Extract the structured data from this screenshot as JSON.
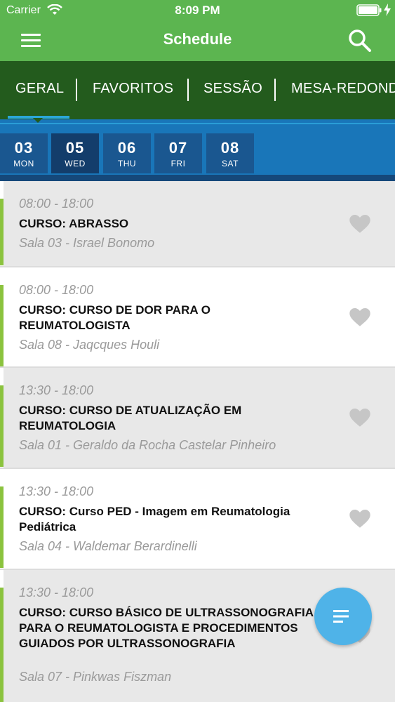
{
  "status_bar": {
    "carrier": "Carrier",
    "time": "8:09 PM"
  },
  "nav": {
    "title": "Schedule",
    "menu_icon": "hamburger-icon",
    "search_icon": "search-icon"
  },
  "tabs": [
    {
      "label": "GERAL",
      "selected": true
    },
    {
      "label": "FAVORITOS",
      "selected": false
    },
    {
      "label": "SESSÃO",
      "selected": false
    },
    {
      "label": "MESA-REDONDA",
      "selected": false
    }
  ],
  "dates": [
    {
      "num": "03",
      "day": "MON",
      "selected": false
    },
    {
      "num": "05",
      "day": "WED",
      "selected": true
    },
    {
      "num": "06",
      "day": "THU",
      "selected": false
    },
    {
      "num": "07",
      "day": "FRI",
      "selected": false
    },
    {
      "num": "08",
      "day": "SAT",
      "selected": false
    }
  ],
  "sessions": [
    {
      "time": "08:00 - 18:00",
      "title": "CURSO: ABRASSO",
      "room": "Sala 03 - Israel Bonomo",
      "favorite": false
    },
    {
      "time": "08:00 - 18:00",
      "title": "CURSO: CURSO DE DOR PARA O REUMATOLOGISTA",
      "room": "Sala 08 - Jaqcques Houli",
      "favorite": false
    },
    {
      "time": "13:30 - 18:00",
      "title": "CURSO: CURSO DE ATUALIZAÇÃO EM REUMATOLOGIA",
      "room": "Sala 01 - Geraldo da Rocha Castelar Pinheiro",
      "favorite": false
    },
    {
      "time": "13:30 - 18:00",
      "title": "CURSO: Curso PED - Imagem em Reumatologia Pediátrica",
      "room": "Sala 04 - Waldemar Berardinelli",
      "favorite": false
    },
    {
      "time": "13:30 - 18:00",
      "title": "CURSO: CURSO BÁSICO DE ULTRASSONOGRAFIA PARA O REUMATOLOGISTA E PROCEDIMENTOS GUIADOS POR ULTRASSONOGRAFIA",
      "room": "Sala 07 - Pinkwas Fiszman",
      "favorite": false
    }
  ],
  "fab": {
    "icon": "filter-list-icon"
  },
  "colors": {
    "header_green": "#5cb550",
    "tab_dark_green": "#235b1d",
    "date_blue": "#1976b9",
    "accent_lime": "#8bc33e",
    "fab_blue": "#4fb3e8"
  }
}
